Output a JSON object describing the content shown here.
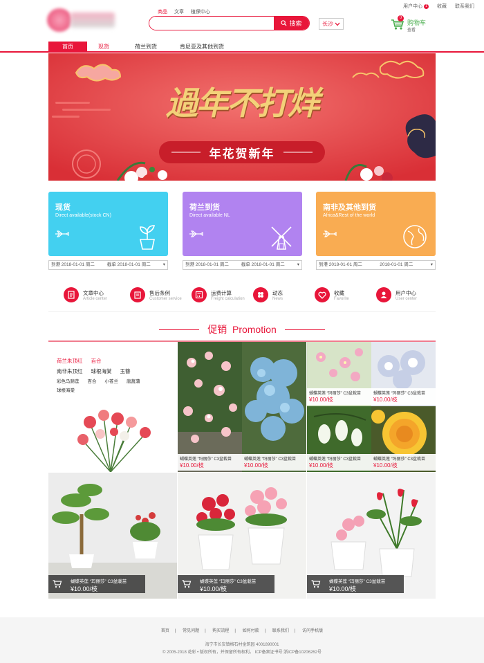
{
  "header": {
    "top_nav": [
      "商品",
      "文章",
      "植保中心"
    ],
    "user_center": "用户中心",
    "user_badge": "1",
    "favorites": "收藏",
    "contact": "联系我们",
    "search_button": "搜索",
    "city": "长沙",
    "cart_label": "购物车",
    "cart_sub": "查看",
    "cart_count": "0"
  },
  "main_nav": [
    "首页",
    "现货",
    "荷兰到货",
    "肯尼亚及其他到货"
  ],
  "banner": {
    "headline": "過年不打烊",
    "subline": "年花贺新年"
  },
  "cards": [
    {
      "title": "现货",
      "subtitle": "Direct available(stock CN)",
      "color": "#43d0f0",
      "date_from": "到港 2018-01-01 周二",
      "date_to": "截单 2018-01-01 周二"
    },
    {
      "title": "荷兰到货",
      "subtitle": "Direct available NL",
      "color": "#b183f0",
      "date_from": "到港 2018-01-01 周二",
      "date_to": "截单 2018-01-01 周二"
    },
    {
      "title": "南非及其他到货",
      "subtitle": "Africa&Rest of the world",
      "color": "#f9ac52",
      "date_from": "到港 2018-01-01 周二",
      "date_to": "2018-01-01 周二"
    }
  ],
  "shortcuts": [
    {
      "label": "文章中心",
      "en": "Article center",
      "icon": "document-icon"
    },
    {
      "label": "售后条例",
      "en": "Customer service",
      "icon": "service-icon"
    },
    {
      "label": "运费计算",
      "en": "Freight calculation",
      "icon": "calculator-icon"
    },
    {
      "label": "动态",
      "en": "News",
      "icon": "news-icon"
    },
    {
      "label": "收藏",
      "en": "Favorite",
      "icon": "heart-icon"
    },
    {
      "label": "用户中心",
      "en": "User center",
      "icon": "user-icon"
    }
  ],
  "promo": {
    "title": "促销",
    "title_en": "Promotion",
    "tags_row1": [
      "荷兰朱顶红",
      "百合"
    ],
    "tags_row2": [
      "南非朱顶红",
      "球根海棠",
      "玉簪"
    ],
    "tags_row3": [
      "彩色马蹄莲",
      "百合",
      "小苍兰",
      "唐菖蒲"
    ],
    "tags_row4": [
      "球根海棠"
    ]
  },
  "products": [
    {
      "name": "蝴蝶英莲 “玛丽莎” C3盆栽苗",
      "price": "¥10.00/枝"
    },
    {
      "name": "蝴蝶英莲 “玛丽莎” C3盆栽苗",
      "price": "¥10.00/枝"
    },
    {
      "name": "蝴蝶英莲 “玛丽莎” C3盆栽苗",
      "price": "¥10.00/枝"
    },
    {
      "name": "蝴蝶英莲 “玛丽莎” C3盆栽苗",
      "price": "¥10.00/枝"
    },
    {
      "name": "蝴蝶英莲 “玛丽莎” C3盆栽苗",
      "price": "¥10.00/枝"
    },
    {
      "name": "蝴蝶英莲 “玛丽莎” C3盆栽苗",
      "price": "¥10.00/枝"
    }
  ],
  "big_products": [
    {
      "name": "蝴蝶英莲 “玛丽莎” C3盆栽苗",
      "price": "¥10.00/枝"
    },
    {
      "name": "蝴蝶英莲 “玛丽莎” C3盆栽苗",
      "price": "¥10.00/枝"
    },
    {
      "name": "蝴蝶英莲 “玛丽莎” C3盆栽苗",
      "price": "¥10.00/枝"
    }
  ],
  "footer": {
    "links": [
      "首页",
      "常见问题",
      "购买流程",
      "如何付款",
      "联系我们",
      "访问手机版"
    ],
    "address": "海宁市长安镇格石村金筑园 4001890001",
    "copyright": "© 2005-2018 花彩 • 版权所有，并保留所有权利。 ICP备案证书号:浙ICP备10206262号"
  }
}
